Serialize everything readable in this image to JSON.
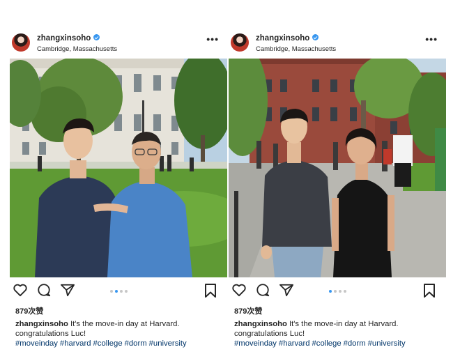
{
  "posts": [
    {
      "username": "zhangxinsoho",
      "location": "Cambridge, Massachusetts",
      "more": "•••",
      "likes": "879次赞",
      "caption_text": "It's the move-in day at Harvard. congratulations Luc!",
      "hashtags": [
        "#moveinday",
        "#harvard",
        "#college",
        "#dorm",
        "#university"
      ],
      "carousel": {
        "count": 4,
        "active": 2
      },
      "photo_desc": "student with father on campus lawn"
    },
    {
      "username": "zhangxinsoho",
      "location": "Cambridge, Massachusetts",
      "more": "•••",
      "likes": "879次赞",
      "caption_text": "It's the move-in day at Harvard. congratulations Luc!",
      "hashtags": [
        "#moveinday",
        "#harvard",
        "#college",
        "#dorm",
        "#university"
      ],
      "carousel": {
        "count": 4,
        "active": 1
      },
      "photo_desc": "student with mother on campus walkway"
    }
  ],
  "colors": {
    "text": "#262626",
    "hashtag": "#003569",
    "verified": "#3897f0",
    "dot_active": "#3897f0",
    "dot_inactive": "#c7c7c7"
  },
  "icons": [
    "heart-icon",
    "comment-icon",
    "share-icon",
    "bookmark-icon",
    "verified-badge-icon",
    "more-options-icon"
  ]
}
